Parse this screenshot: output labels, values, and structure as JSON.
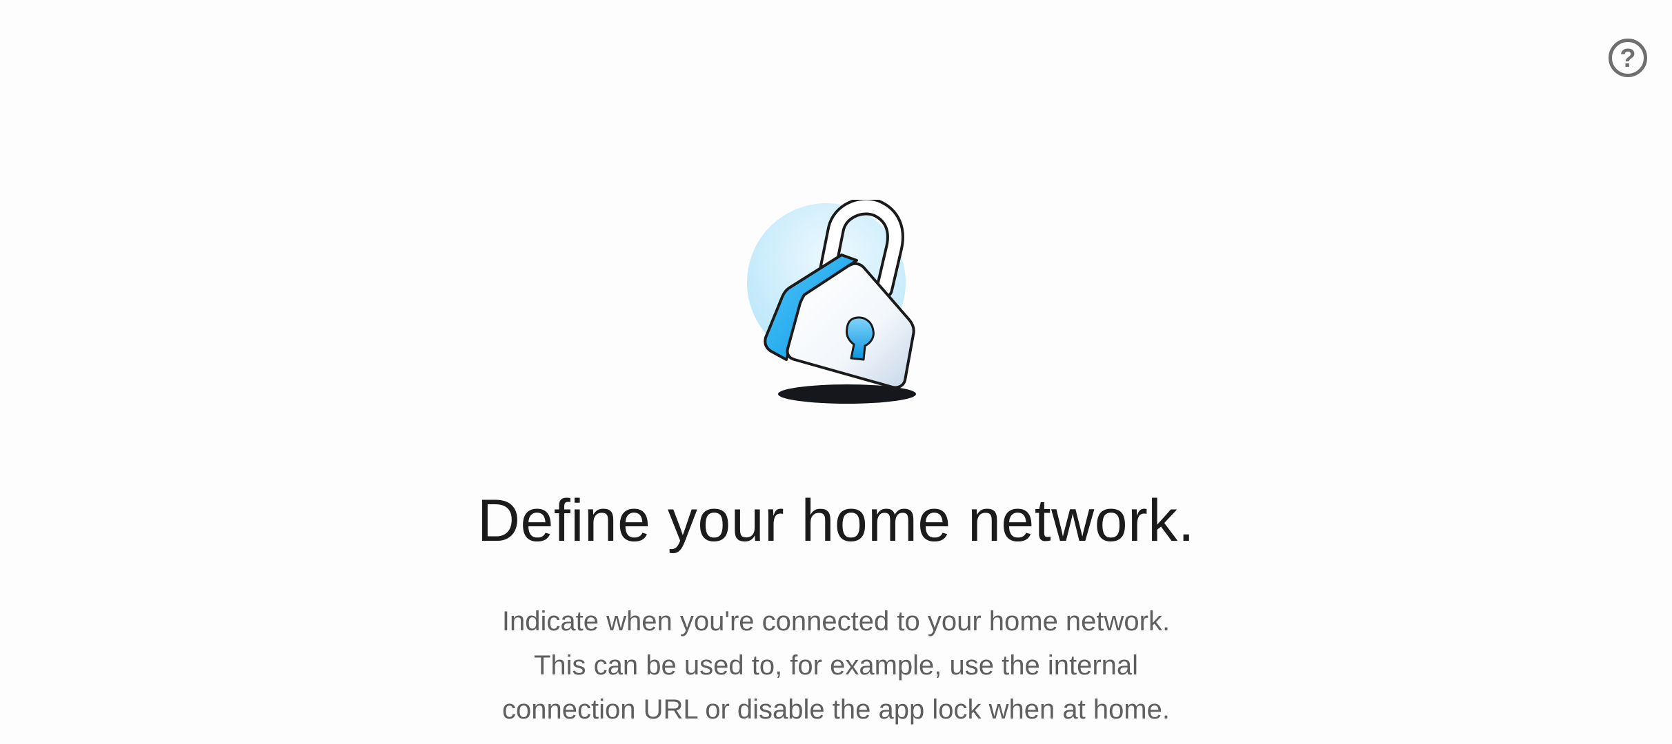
{
  "header": {
    "help_icon": "help-circle-icon",
    "help_glyph": "?"
  },
  "illustration": {
    "icon": "padlock-icon",
    "accent_color": "#29b6f6",
    "circle_color": "#d6f1fc"
  },
  "content": {
    "title": "Define your home network.",
    "description": "Indicate when you're connected to your home network. This can be used to, for example, use the internal connection URL or disable the app lock when at home."
  },
  "colors": {
    "background": "#fdfdfd",
    "title_text": "#1b1b1b",
    "body_text": "#5f5f5f",
    "icon_gray": "#6f6f6f"
  }
}
